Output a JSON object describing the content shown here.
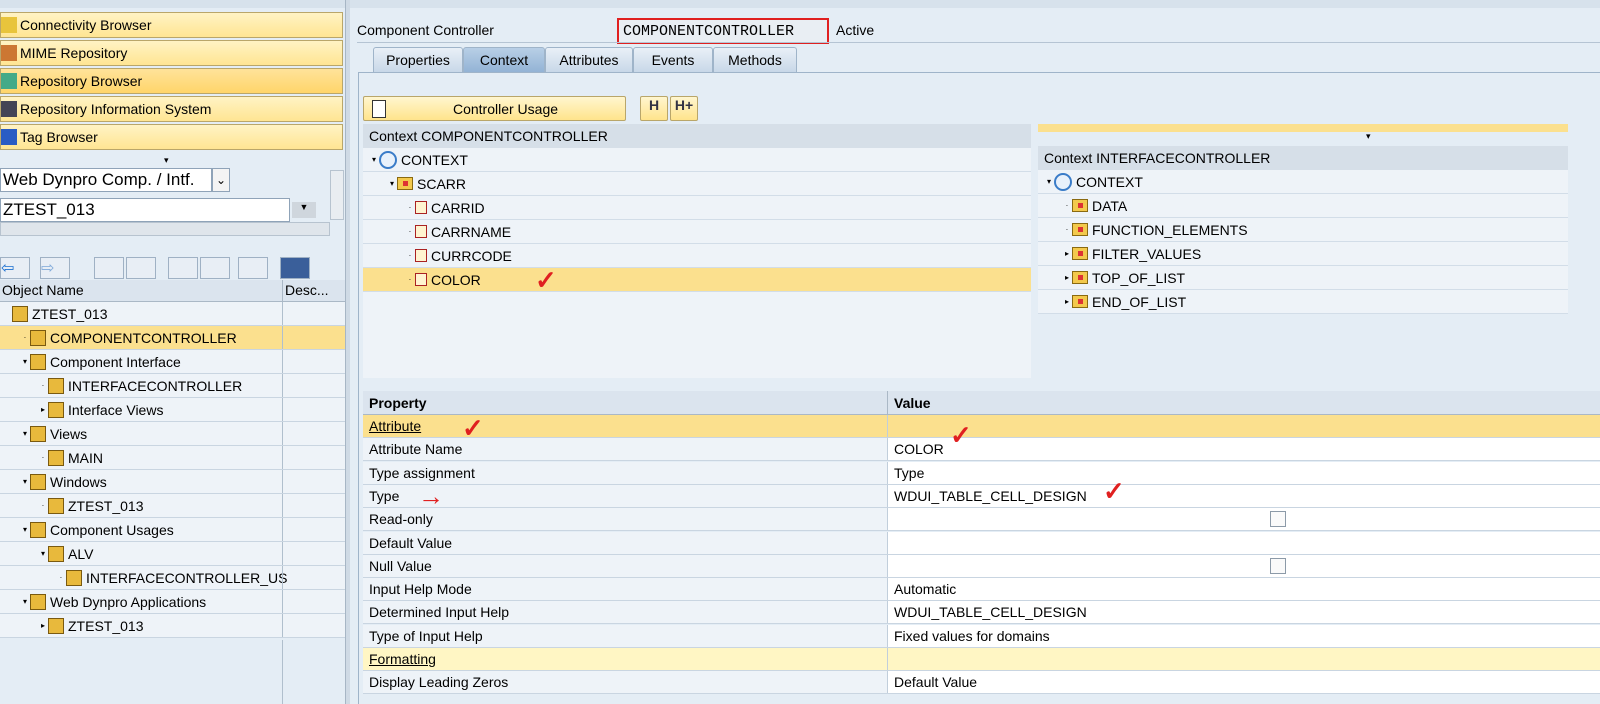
{
  "nav": {
    "buttons": [
      "Connectivity Browser",
      "MIME Repository",
      "Repository Browser",
      "Repository Information System",
      "Tag Browser"
    ]
  },
  "selector": {
    "type": "Web Dynpro Comp. / Intf.",
    "name": "ZTEST_013"
  },
  "tree": {
    "col_object": "Object Name",
    "col_desc": "Desc...",
    "rows": [
      {
        "label": "ZTEST_013",
        "indent": 0,
        "tw": ""
      },
      {
        "label": "COMPONENTCONTROLLER",
        "indent": 1,
        "tw": "·",
        "sel": true
      },
      {
        "label": "Component Interface",
        "indent": 1,
        "tw": "▾"
      },
      {
        "label": "INTERFACECONTROLLER",
        "indent": 2,
        "tw": "·"
      },
      {
        "label": "Interface Views",
        "indent": 2,
        "tw": "▸"
      },
      {
        "label": "Views",
        "indent": 1,
        "tw": "▾"
      },
      {
        "label": "MAIN",
        "indent": 2,
        "tw": "·"
      },
      {
        "label": "Windows",
        "indent": 1,
        "tw": "▾"
      },
      {
        "label": "ZTEST_013",
        "indent": 2,
        "tw": "·"
      },
      {
        "label": "Component Usages",
        "indent": 1,
        "tw": "▾"
      },
      {
        "label": "ALV",
        "indent": 2,
        "tw": "▾"
      },
      {
        "label": "INTERFACECONTROLLER_US",
        "indent": 3,
        "tw": "·"
      },
      {
        "label": "Web Dynpro Applications",
        "indent": 1,
        "tw": "▾"
      },
      {
        "label": "ZTEST_013",
        "indent": 2,
        "tw": "▸"
      }
    ]
  },
  "header": {
    "label": "Component Controller",
    "name": "COMPONENTCONTROLLER",
    "status": "Active"
  },
  "tabs": [
    "Properties",
    "Context",
    "Attributes",
    "Events",
    "Methods"
  ],
  "controller_usage": "Controller Usage",
  "context_left": {
    "title": "Context COMPONENTCONTROLLER",
    "rows": [
      {
        "label": "CONTEXT",
        "kind": "root",
        "indent": 0,
        "tw": "▾"
      },
      {
        "label": "SCARR",
        "kind": "node",
        "indent": 1,
        "tw": "▾"
      },
      {
        "label": "CARRID",
        "kind": "attr",
        "indent": 2,
        "tw": "·"
      },
      {
        "label": "CARRNAME",
        "kind": "attr",
        "indent": 2,
        "tw": "·"
      },
      {
        "label": "CURRCODE",
        "kind": "attr",
        "indent": 2,
        "tw": "·"
      },
      {
        "label": "COLOR",
        "kind": "attr",
        "indent": 2,
        "tw": "·",
        "sel": true
      }
    ]
  },
  "context_right": {
    "title": "Context INTERFACECONTROLLER",
    "rows": [
      {
        "label": "CONTEXT",
        "kind": "root",
        "indent": 0,
        "tw": "▾"
      },
      {
        "label": "DATA",
        "kind": "node",
        "indent": 1,
        "tw": "·"
      },
      {
        "label": "FUNCTION_ELEMENTS",
        "kind": "node",
        "indent": 1,
        "tw": "·"
      },
      {
        "label": "FILTER_VALUES",
        "kind": "node",
        "indent": 1,
        "tw": "▸"
      },
      {
        "label": "TOP_OF_LIST",
        "kind": "node",
        "indent": 1,
        "tw": "▸"
      },
      {
        "label": "END_OF_LIST",
        "kind": "node",
        "indent": 1,
        "tw": "▸"
      }
    ]
  },
  "properties": {
    "col_property": "Property",
    "col_value": "Value",
    "rows": [
      {
        "p": "Attribute",
        "v": "",
        "grp": "grp"
      },
      {
        "p": "Attribute Name",
        "v": "COLOR"
      },
      {
        "p": "Type assignment",
        "v": "Type"
      },
      {
        "p": "Type",
        "v": "WDUI_TABLE_CELL_DESIGN"
      },
      {
        "p": "Read-only",
        "v": "",
        "chk": true
      },
      {
        "p": "Default Value",
        "v": ""
      },
      {
        "p": "Null Value",
        "v": "",
        "chk": true
      },
      {
        "p": "Input Help Mode",
        "v": "Automatic"
      },
      {
        "p": "Determined Input Help",
        "v": "WDUI_TABLE_CELL_DESIGN"
      },
      {
        "p": "Type of Input Help",
        "v": "Fixed values for domains"
      },
      {
        "p": "Formatting",
        "v": "",
        "grp": "grp2"
      },
      {
        "p": "Display Leading Zeros",
        "v": "Default Value"
      }
    ]
  }
}
